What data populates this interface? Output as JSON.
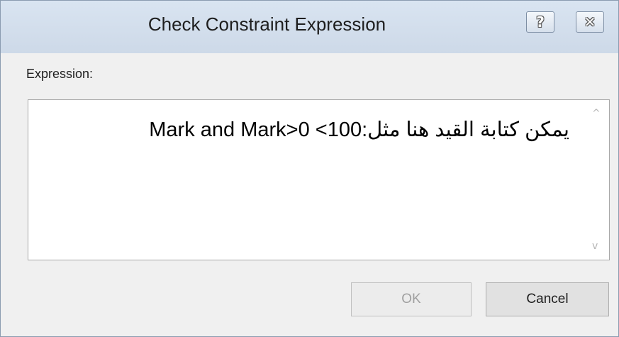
{
  "window": {
    "title": "Check Constraint Expression",
    "help_icon": "question-mark",
    "close_icon": "close-x",
    "help_glyph": "?",
    "close_glyph": "✕"
  },
  "form": {
    "expression_label": "Expression:",
    "expression_value": "يمكن كتابة القيد هنا مثل:100> Mark and Mark>0",
    "scroll_up_glyph": "^",
    "scroll_down_glyph": "v"
  },
  "buttons": {
    "ok_label": "OK",
    "ok_enabled": false,
    "cancel_label": "Cancel"
  }
}
